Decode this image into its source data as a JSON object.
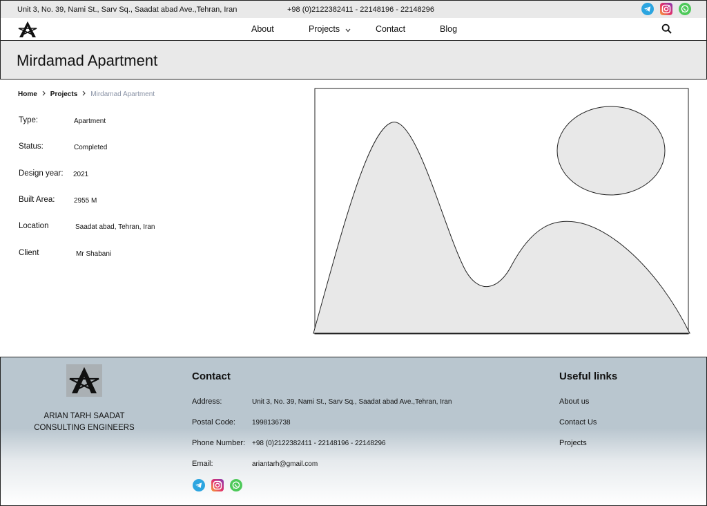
{
  "topbar": {
    "address": "Unit 3, No. 39, Nami St., Sarv Sq., Saadat abad Ave.,Tehran, Iran",
    "phone": "+98 (0)2122382411 - 22148196 - 22148296",
    "socials": [
      "telegram-icon",
      "instagram-icon",
      "whatsapp-icon"
    ]
  },
  "nav": {
    "items": [
      {
        "label": "About"
      },
      {
        "label": "Projects"
      },
      {
        "label": "Contact"
      },
      {
        "label": "Blog"
      }
    ]
  },
  "page": {
    "title": "Mirdamad Apartment"
  },
  "breadcrumb": {
    "home": "Home",
    "projects": "Projects",
    "current": "Mirdamad Apartment"
  },
  "details": [
    {
      "label": "Type:",
      "value": "Apartment"
    },
    {
      "label": "Status:",
      "value": "Completed"
    },
    {
      "label": "Design year:",
      "value": "2021"
    },
    {
      "label": "Built Area:",
      "value": "2955 M"
    },
    {
      "label": "Location",
      "value": "Saadat abad, Tehran, Iran"
    },
    {
      "label": "Client",
      "value": "Mr Shabani"
    }
  ],
  "footer": {
    "company_line1": "ARIAN TARH SAADAT",
    "company_line2": "CONSULTING ENGINEERS",
    "contact_heading": "Contact",
    "contact": [
      {
        "label": "Address:",
        "value": "Unit 3, No. 39, Nami St., Sarv Sq., Saadat abad Ave.,Tehran, Iran"
      },
      {
        "label": "Postal Code:",
        "value": "1998136738"
      },
      {
        "label": "Phone Number:",
        "value": "+98 (0)2122382411 - 22148196 - 22148296"
      },
      {
        "label": "Email:",
        "value": "ariantarh@gmail.com"
      }
    ],
    "links_heading": "Useful links",
    "links": [
      "About us",
      "Contact Us",
      "Projects"
    ]
  },
  "colors": {
    "telegram": "#2ca5e0",
    "whatsapp": "#4ec95a",
    "footer_bg": "#b9c6cf",
    "breadcrumb_current": "#8a93a6"
  }
}
